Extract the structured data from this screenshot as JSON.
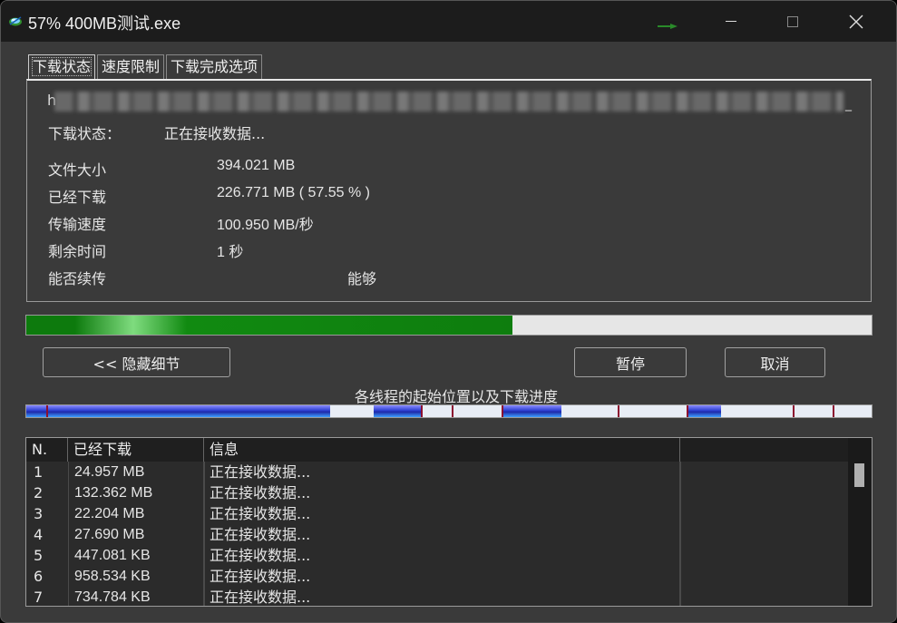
{
  "window": {
    "title": "57% 400MB测试.exe"
  },
  "tabs": [
    {
      "label": "下载状态"
    },
    {
      "label": "速度限制"
    },
    {
      "label": "下载完成选项"
    }
  ],
  "url": {
    "prefix": "h",
    "suffix": "_"
  },
  "status": {
    "label": "下载状态：",
    "value": "正在接收数据..."
  },
  "info": [
    {
      "label": "文件大小",
      "value": "394.021  MB"
    },
    {
      "label": "已经下载",
      "value": "226.771  MB  ( 57.55 % )"
    },
    {
      "label": "传输速度",
      "value": "100.950  MB/秒"
    },
    {
      "label": "剩余时间",
      "value": "1  秒"
    },
    {
      "label": "能否续传",
      "value": "能够"
    }
  ],
  "progress": {
    "fraction": 0.5755
  },
  "buttons": {
    "hide_details": "<< 隐藏细节",
    "pause": "暂停",
    "cancel": "取消"
  },
  "threads": {
    "label": "各线程的起始位置以及下载进度"
  },
  "table": {
    "headers": [
      "N.",
      "已经下载",
      "信息",
      ""
    ],
    "rows": [
      {
        "n": "1",
        "downloaded": "24.957  MB",
        "info": "正在接收数据..."
      },
      {
        "n": "2",
        "downloaded": "132.362  MB",
        "info": "正在接收数据..."
      },
      {
        "n": "3",
        "downloaded": "22.204  MB",
        "info": "正在接收数据..."
      },
      {
        "n": "4",
        "downloaded": "27.690  MB",
        "info": "正在接收数据..."
      },
      {
        "n": "5",
        "downloaded": "447.081  KB",
        "info": "正在接收数据..."
      },
      {
        "n": "6",
        "downloaded": "958.534  KB",
        "info": "正在接收数据..."
      },
      {
        "n": "7",
        "downloaded": "734.784  KB",
        "info": "正在接收数据..."
      }
    ]
  },
  "colors": {
    "progress_green": "#0e7d0e",
    "thread_blue": "#2a3fd0",
    "thread_marker": "#8c1030",
    "background": "#3a3a3a"
  },
  "icons": {
    "app": "download-app-icon",
    "minimize": "minimize-icon",
    "maximize": "maximize-icon",
    "close": "close-icon"
  }
}
